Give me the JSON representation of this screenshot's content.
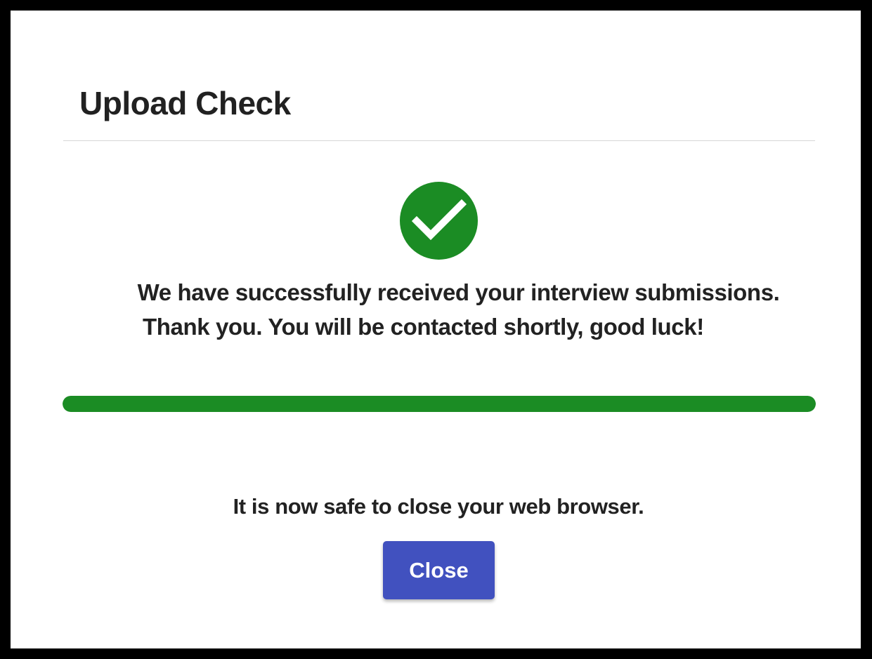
{
  "dialog": {
    "title": "Upload Check"
  },
  "status": {
    "icon": "check-circle-icon",
    "color": "#1b8c24",
    "message_line1": "We have successfully received your interview submissions.",
    "message_line2": "Thank you. You will be contacted shortly, good luck!"
  },
  "progress": {
    "percent": 100,
    "color": "#1b8c24"
  },
  "footer": {
    "safe_message": "It is now safe to close your web browser.",
    "close_label": "Close",
    "close_color": "#4151bf"
  }
}
